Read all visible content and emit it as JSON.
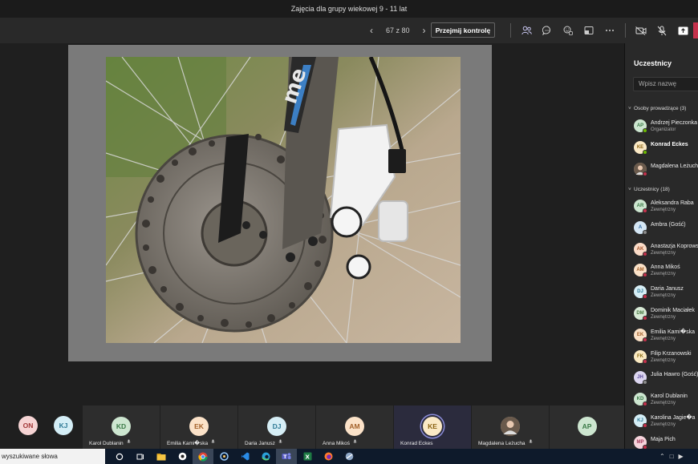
{
  "window": {
    "title": "Zajęcia dla grupy wiekowej 9 - 11 lat"
  },
  "toolbar": {
    "slide_counter": "67 z 80",
    "takeover_label": "Przejmij kontrolę"
  },
  "panel": {
    "title": "Uczestnicy",
    "search_placeholder": "Wpisz nazwę",
    "presenters_header": "Osoby prowadzące (3)",
    "presenters": [
      {
        "initials": "AP",
        "name": "Andrzej Pieczonka",
        "sub": "Organizator",
        "bg": "#cde6d0",
        "fg": "#3b7a47",
        "dot": "#6bb700"
      },
      {
        "initials": "KE",
        "name": "Konrad Eckes",
        "sub": "",
        "bg": "#fbe9c5",
        "fg": "#8a6212",
        "dot": "#6bb700",
        "bold": true
      },
      {
        "initials": "",
        "name": "Magdalena Leżucha",
        "sub": "",
        "bg": "#b0a090",
        "fg": "#fff",
        "dot": "#c4314b",
        "photo": true
      }
    ],
    "attendees_header": "Uczestnicy (18)",
    "attendees": [
      {
        "initials": "AR",
        "name": "Aleksandra Raba",
        "sub": "Zewnętrzny",
        "bg": "#cde6d0",
        "fg": "#3b7a47",
        "dot": "#c4314b"
      },
      {
        "initials": "A",
        "name": "Ambra (Gość)",
        "sub": "",
        "bg": "#d4e6f4",
        "fg": "#2f6aa3",
        "dot": "#8a8a8a"
      },
      {
        "initials": "AK",
        "name": "Anastazja Koprowska",
        "sub": "Zewnętrzny",
        "bg": "#fbdcc8",
        "fg": "#a3522a",
        "dot": "#c4314b"
      },
      {
        "initials": "AM",
        "name": "Anna Mikoś",
        "sub": "Zewnętrzny",
        "bg": "#fbe2c8",
        "fg": "#a3612a",
        "dot": "#c4314b"
      },
      {
        "initials": "DJ",
        "name": "Daria Janusz",
        "sub": "Zewnętrzny",
        "bg": "#d6eef6",
        "fg": "#2f7a96",
        "dot": "#c4314b"
      },
      {
        "initials": "DM",
        "name": "Dominik Maciałek",
        "sub": "Zewnętrzny",
        "bg": "#d8ead6",
        "fg": "#4a7a44",
        "dot": "#c4314b"
      },
      {
        "initials": "EK",
        "name": "Emilia Kami�ska",
        "sub": "Zewnętrzny",
        "bg": "#fbe2c8",
        "fg": "#a3612a",
        "dot": "#c4314b"
      },
      {
        "initials": "FK",
        "name": "Filip Krzanowski",
        "sub": "Zewnętrzny",
        "bg": "#fbeac2",
        "fg": "#8a6a12",
        "dot": "#c4314b"
      },
      {
        "initials": "JH",
        "name": "Julia Hawro (Gość)",
        "sub": "",
        "bg": "#dcd6f0",
        "fg": "#5a4a9a",
        "dot": "#8a8a8a"
      },
      {
        "initials": "KD",
        "name": "Karol Dublanin",
        "sub": "Zewnętrzny",
        "bg": "#cde6d0",
        "fg": "#3b7a47",
        "dot": "#c4314b"
      },
      {
        "initials": "KJ",
        "name": "Karolina Jagie�a",
        "sub": "Zewnętrzny",
        "bg": "#d4eef6",
        "fg": "#2f7a96",
        "dot": "#c4314b"
      },
      {
        "initials": "MP",
        "name": "Maja Pich",
        "sub": "",
        "bg": "#f6d4dc",
        "fg": "#a33a5a",
        "dot": "#c4314b"
      }
    ]
  },
  "strip": {
    "small": [
      {
        "initials": "ON",
        "bg": "#f6d4d4",
        "fg": "#a33a3a"
      },
      {
        "initials": "KJ",
        "bg": "#d4eef6",
        "fg": "#2f7a96"
      }
    ],
    "tiles": [
      {
        "initials": "KD",
        "name": "Karol Dublanin",
        "bg": "#cde6d0",
        "fg": "#3b7a47"
      },
      {
        "initials": "EK",
        "name": "Emilia Kami�ska",
        "bg": "#fbe2c8",
        "fg": "#a3612a"
      },
      {
        "initials": "DJ",
        "name": "Daria Janusz",
        "bg": "#d6eef6",
        "fg": "#2f7a96"
      },
      {
        "initials": "AM",
        "name": "Anna Mikoś",
        "bg": "#fbe2c8",
        "fg": "#a3612a"
      },
      {
        "initials": "KE",
        "name": "Konrad Eckes",
        "bg": "#fbe9c5",
        "fg": "#8a6212",
        "speaking": true
      },
      {
        "initials": "",
        "name": "Magdalena Leżucha",
        "bg": "#b0a090",
        "fg": "#fff",
        "photo": true
      },
      {
        "initials": "AP",
        "name": "",
        "bg": "#cde6d0",
        "fg": "#3b7a47"
      }
    ]
  },
  "taskbar": {
    "search_text": "wyszukiwane słowa"
  },
  "colors": {
    "accent": "#6264a7",
    "busy": "#c4314b",
    "available": "#6bb700"
  }
}
